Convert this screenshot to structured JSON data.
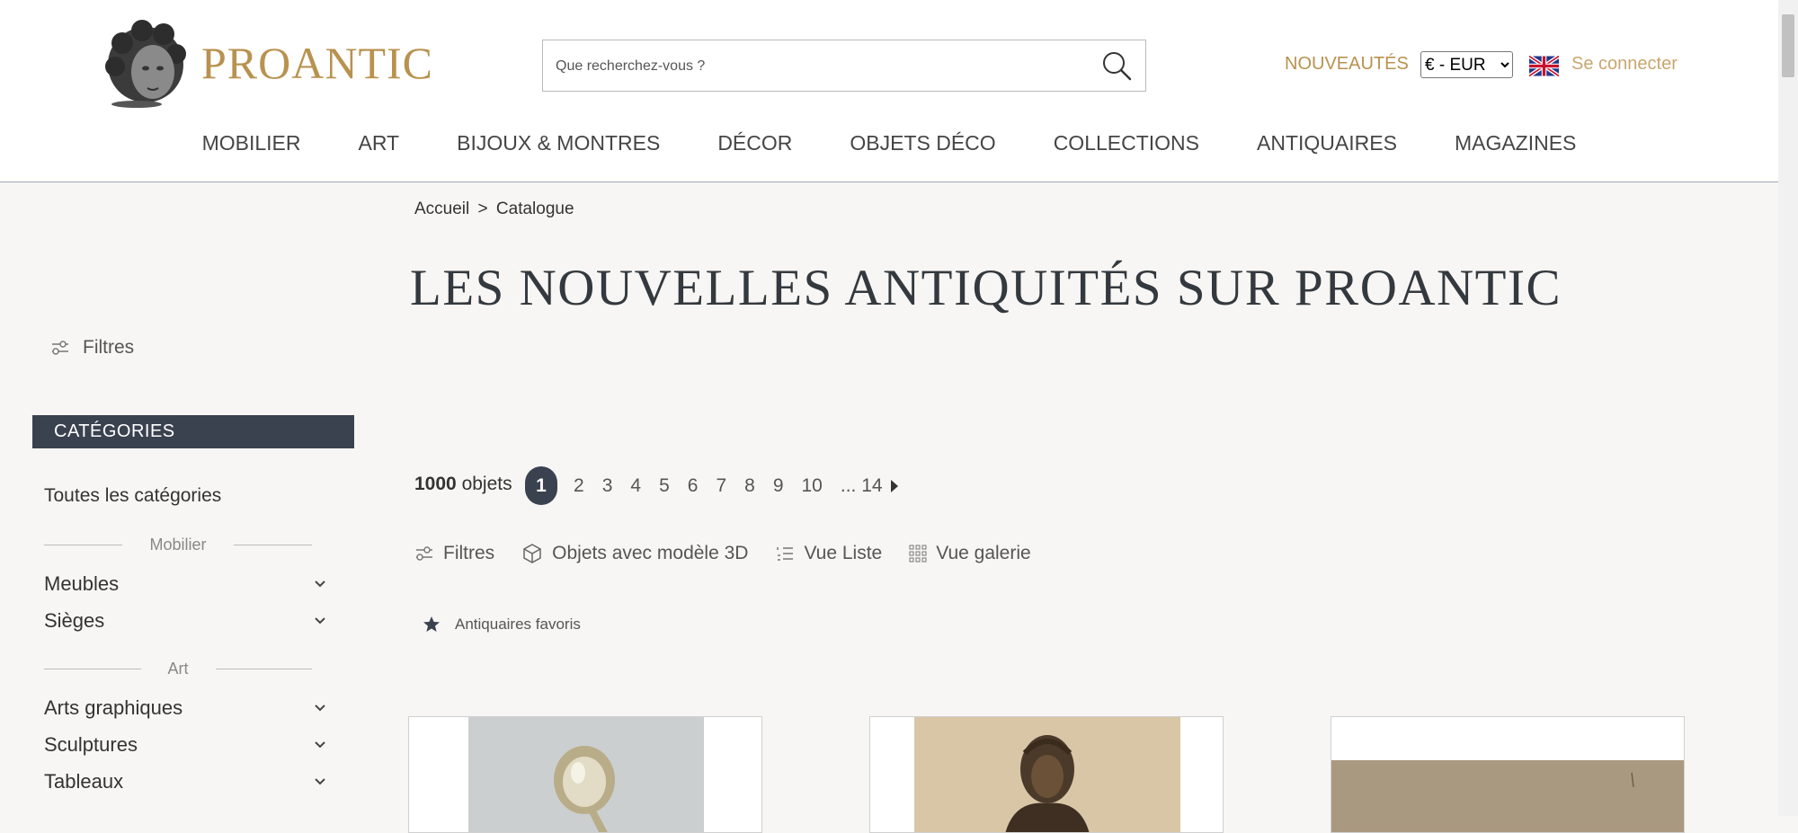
{
  "header": {
    "brand": "PROANTIC",
    "search_placeholder": "Que recherchez-vous ?",
    "nouveautes": "NOUVEAUTÉS",
    "currency": "€ - EUR",
    "login": "Se connecter",
    "accent_color": "#b8924f"
  },
  "nav": [
    "MOBILIER",
    "ART",
    "BIJOUX & MONTRES",
    "DÉCOR",
    "OBJETS DÉCO",
    "COLLECTIONS",
    "ANTIQUAIRES",
    "MAGAZINES"
  ],
  "breadcrumb": {
    "home": "Accueil",
    "separator": ">",
    "current": "Catalogue"
  },
  "page_title": "LES NOUVELLES ANTIQUITÉS SUR PROANTIC",
  "sidebar": {
    "filters_label": "Filtres",
    "categories_header": "CATÉGORIES",
    "all_categories": "Toutes les catégories",
    "groups": [
      {
        "label": "Mobilier",
        "items": [
          "Meubles",
          "Sièges"
        ]
      },
      {
        "label": "Art",
        "items": [
          "Arts graphiques",
          "Sculptures",
          "Tableaux"
        ]
      }
    ]
  },
  "results": {
    "count": "1000",
    "count_suffix": "objets",
    "pages": [
      "1",
      "2",
      "3",
      "4",
      "5",
      "6",
      "7",
      "8",
      "9",
      "10"
    ],
    "current_page": "1",
    "last_page": "... 14"
  },
  "toolbar": {
    "filters": "Filtres",
    "objects_3d": "Objets avec modèle 3D",
    "list_view": "Vue Liste",
    "gallery_view": "Vue galerie",
    "favorites": "Antiquaires favoris"
  },
  "icons": [
    "search-icon",
    "filter-icon",
    "cube-3d-icon",
    "list-icon",
    "grid-icon",
    "star-icon",
    "chevron-down-icon",
    "uk-flag-icon",
    "next-arrow-icon"
  ]
}
